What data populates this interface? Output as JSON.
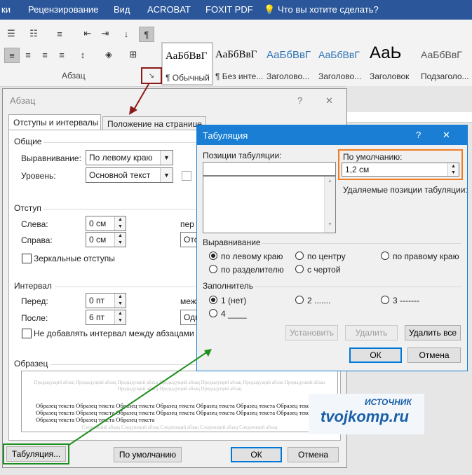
{
  "ribbon": {
    "tabs": [
      "ки",
      "Рецензирование",
      "Вид",
      "ACROBAT",
      "FOXIT PDF"
    ],
    "tell_me": "Что вы хотите сделать?",
    "group_label": "Абзац",
    "styles": [
      {
        "preview": "АаБбВвГ",
        "label": "¶ Обычный"
      },
      {
        "preview": "АаБбВвГ",
        "label": "¶ Без инте..."
      },
      {
        "preview": "АаБбВвГ",
        "label": "Заголово..."
      },
      {
        "preview": "АаБбВвГ",
        "label": "Заголово..."
      },
      {
        "preview": "АаЬ",
        "label": "Заголовок"
      },
      {
        "preview": "АаБбВвГ",
        "label": "Подзаголо..."
      }
    ]
  },
  "abzac": {
    "title": "Абзац",
    "help": "?",
    "close": "✕",
    "tabs": [
      "Отступы и интервалы",
      "Положение на странице"
    ],
    "general": {
      "heading": "Общие",
      "align_label": "Выравнивание:",
      "align_value": "По левому краю",
      "level_label": "Уровень:",
      "level_value": "Основной текст"
    },
    "indent": {
      "heading": "Отступ",
      "left_label": "Слева:",
      "left_value": "0 см",
      "right_label": "Справа:",
      "right_value": "0 см",
      "first_label": "пер",
      "first_value": "Отс",
      "mirror_label": "Зеркальные отступы"
    },
    "spacing": {
      "heading": "Интервал",
      "before_label": "Перед:",
      "before_value": "0 пт",
      "after_label": "После:",
      "after_value": "6 пт",
      "line_label": "меж",
      "line_value": "Оди",
      "no_add_label": "Не добавлять интервал между абзацами од"
    },
    "sample": {
      "heading": "Образец",
      "prev_text": "Предыдущий абзац Предыдущий абзац Предыдущий абзац Предыдущий абзац Предыдущий абзац Предыдущий абзац Предыдущий абзац Предыдущий абзац Предыдущий абзац Предыдущий абзац",
      "sample_text": "Образец текста Образец текста Образец текста Образец текста Образец текста Образец текста Образец текста Образец текста Образец текста Образец текста Образец текста Образец текста Образец текста Образец текста Образец текста Образец текста Образец текста",
      "next_text": "Следующий абзац Следующий абзац Следующий абзац Следующий абзац Следующий абзац"
    },
    "buttons": {
      "tabs": "Табуляция...",
      "default": "По умолчанию",
      "ok": "ОК",
      "cancel": "Отмена"
    }
  },
  "tabulation": {
    "title": "Табуляция",
    "help": "?",
    "close": "✕",
    "positions_label": "Позиции табуляции:",
    "positions_value": "",
    "default_label": "По умолчанию:",
    "default_value": "1,2 см",
    "removable_label": "Удаляемые позиции табуляции:",
    "alignment": {
      "heading": "Выравнивание",
      "options": [
        "по левому краю",
        "по центру",
        "по правому краю",
        "по разделителю",
        "с чертой"
      ],
      "selected": "по левому краю"
    },
    "leader": {
      "heading": "Заполнитель",
      "options": [
        "1 (нет)",
        "2 .......",
        "3 -------",
        "4 ____"
      ],
      "selected": "1 (нет)"
    },
    "buttons": {
      "set": "Установить",
      "remove": "Удалить",
      "remove_all": "Удалить все",
      "ok": "ОК",
      "cancel": "Отмена"
    }
  },
  "watermark": {
    "source": "ИСТОЧНИК",
    "site": "tvojkomp.ru"
  },
  "colors": {
    "accent": "#2b579a",
    "dialog_title": "#1a7fd4",
    "highlight_orange": "#f07c22",
    "arrow_red": "#8b1a1a",
    "arrow_green": "#1e8f1e"
  }
}
